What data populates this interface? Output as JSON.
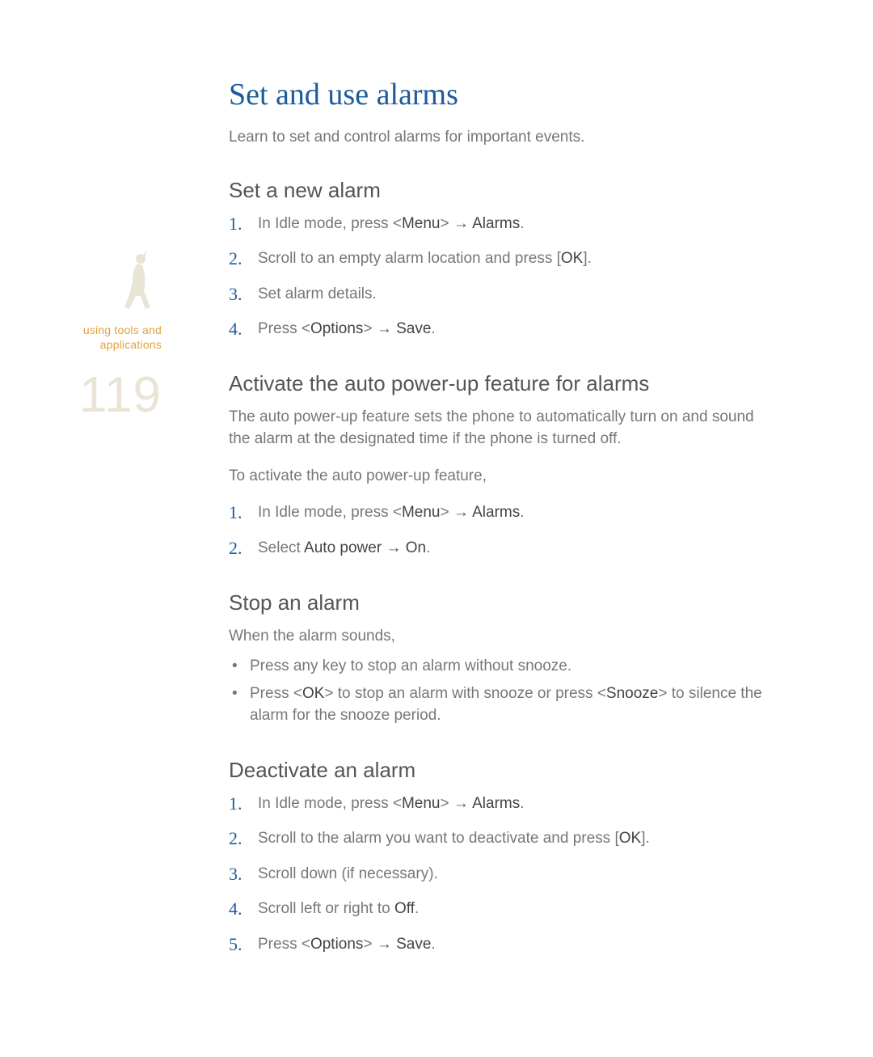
{
  "sidebar": {
    "label_line1": "using tools and",
    "label_line2": "applications",
    "page_number": "119"
  },
  "title": "Set and use alarms",
  "intro": "Learn to set and control alarms for important events.",
  "arrow": "→",
  "sections": {
    "set_new": {
      "heading": "Set a new alarm",
      "steps": [
        {
          "pre": "In Idle mode, press <",
          "b1": "Menu",
          "mid": "> ",
          "arrow": true,
          "b2": " Alarms",
          "post": "."
        },
        {
          "pre": "Scroll to an empty alarm location and press [",
          "b1": "OK",
          "mid": "].",
          "arrow": false,
          "b2": "",
          "post": ""
        },
        {
          "pre": "Set alarm details.",
          "b1": "",
          "mid": "",
          "arrow": false,
          "b2": "",
          "post": ""
        },
        {
          "pre": "Press <",
          "b1": "Options",
          "mid": "> ",
          "arrow": true,
          "b2": " Save",
          "post": "."
        }
      ]
    },
    "auto_power": {
      "heading": "Activate the auto power-up feature for alarms",
      "para1": "The auto power-up feature sets the phone to automatically turn on and sound the alarm at the designated time if the phone is turned off.",
      "para2": "To activate the auto power-up feature,",
      "steps": [
        {
          "pre": "In Idle mode, press <",
          "b1": "Menu",
          "mid": "> ",
          "arrow": true,
          "b2": " Alarms",
          "post": "."
        },
        {
          "pre": "Select ",
          "b1": "Auto power",
          "mid": " ",
          "arrow": true,
          "b2": " On",
          "post": "."
        }
      ]
    },
    "stop": {
      "heading": "Stop an alarm",
      "para": "When the alarm sounds,",
      "bullets": [
        {
          "pre": "Press any key to stop an alarm without snooze."
        },
        {
          "pre": "Press <",
          "b1": "OK",
          "mid": "> to stop an alarm with snooze or press <",
          "b2": "Snooze",
          "post": "> to silence the alarm for the snooze period."
        }
      ]
    },
    "deactivate": {
      "heading": "Deactivate an alarm",
      "steps": [
        {
          "pre": "In Idle mode, press <",
          "b1": "Menu",
          "mid": "> ",
          "arrow": true,
          "b2": " Alarms",
          "post": "."
        },
        {
          "pre": "Scroll to the alarm you want to deactivate and press [",
          "b1": "OK",
          "mid": "].",
          "arrow": false,
          "b2": "",
          "post": ""
        },
        {
          "pre": "Scroll down (if necessary).",
          "b1": "",
          "mid": "",
          "arrow": false,
          "b2": "",
          "post": ""
        },
        {
          "pre": "Scroll left or right to ",
          "b1": "Off",
          "mid": ".",
          "arrow": false,
          "b2": "",
          "post": ""
        },
        {
          "pre": "Press <",
          "b1": "Options",
          "mid": "> ",
          "arrow": true,
          "b2": " Save",
          "post": "."
        }
      ]
    }
  }
}
